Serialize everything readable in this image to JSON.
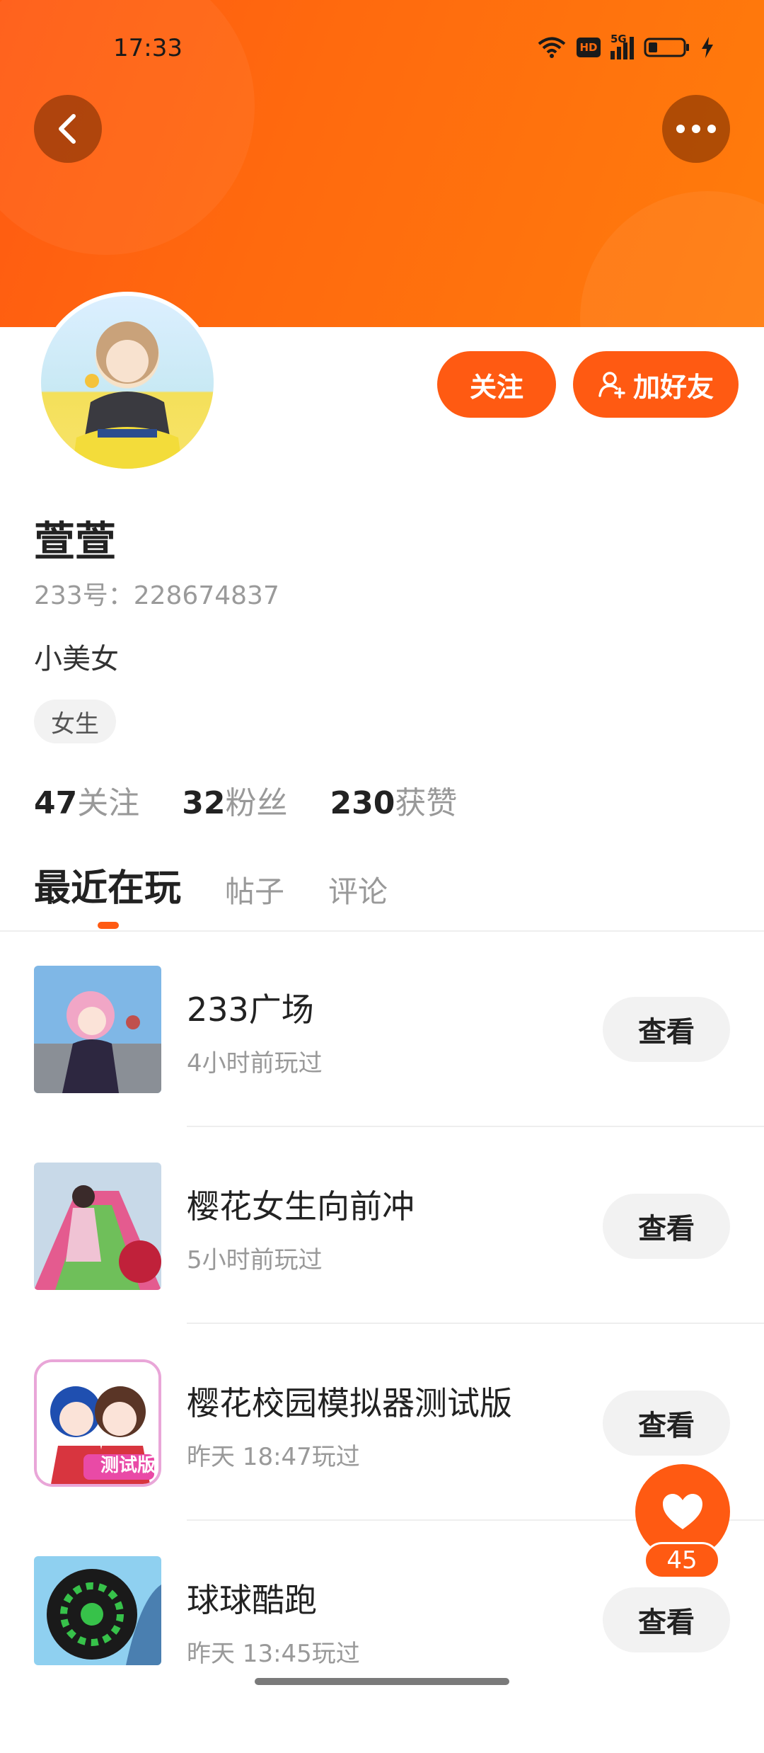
{
  "status_bar": {
    "time": "17:33",
    "network": "5G",
    "hd": "HD"
  },
  "profile": {
    "name": "萱萱",
    "uid_label": "233号：228674837",
    "bio": "小美女",
    "tag": "女生",
    "follow_button": "关注",
    "add_friend_button": "加好友",
    "stats": [
      {
        "value": "47",
        "label": "关注"
      },
      {
        "value": "32",
        "label": "粉丝"
      },
      {
        "value": "230",
        "label": "获赞"
      }
    ]
  },
  "tabs": [
    {
      "label": "最近在玩",
      "active": true
    },
    {
      "label": "帖子",
      "active": false
    },
    {
      "label": "评论",
      "active": false
    }
  ],
  "games": [
    {
      "title": "233广场",
      "subtitle": "4小时前玩过",
      "action": "查看"
    },
    {
      "title": "樱花女生向前冲",
      "subtitle": "5小时前玩过",
      "action": "查看"
    },
    {
      "title": "樱花校园模拟器测试版",
      "subtitle": "昨天 18:47玩过",
      "action": "查看",
      "thumb_badge": "测试版"
    },
    {
      "title": "球球酷跑",
      "subtitle": "昨天 13:45玩过",
      "action": "查看"
    }
  ],
  "like_fab": {
    "count": "45"
  },
  "colors": {
    "accent": "#ff5a12",
    "header_end": "#ff7c0c",
    "muted_text": "#999999"
  }
}
